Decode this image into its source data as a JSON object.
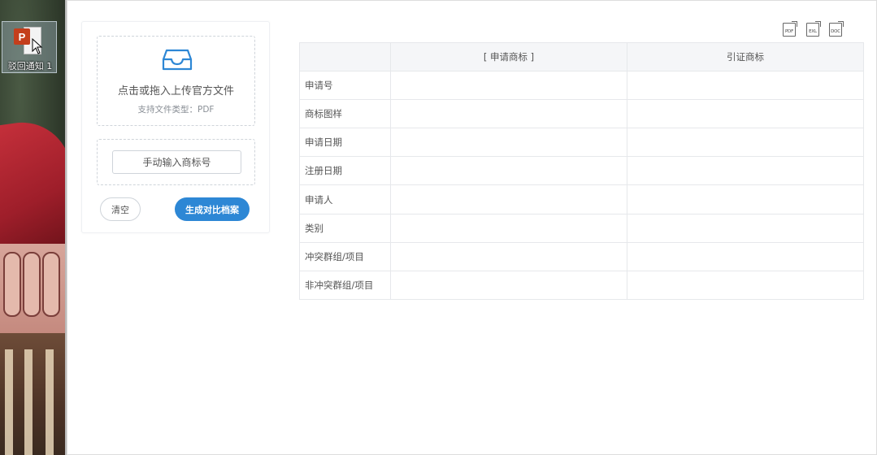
{
  "desktop": {
    "icon_label": "驳回通知 1",
    "icon_badge": "P"
  },
  "upload": {
    "title": "点击或拖入上传官方文件",
    "hint": "支持文件类型：PDF"
  },
  "manual": {
    "button_label": "手动输入商标号"
  },
  "actions": {
    "clear_label": "清空",
    "generate_label": "生成对比档案"
  },
  "export": {
    "pdf_label": "PDF",
    "excel_label": "EXL",
    "doc_label": "DOC"
  },
  "table": {
    "headers": [
      "",
      "[ 申请商标 ]",
      "引证商标"
    ],
    "rows": [
      {
        "label": "申请号",
        "applied": "",
        "cited": ""
      },
      {
        "label": "商标图样",
        "applied": "",
        "cited": ""
      },
      {
        "label": "申请日期",
        "applied": "",
        "cited": ""
      },
      {
        "label": "注册日期",
        "applied": "",
        "cited": ""
      },
      {
        "label": "申请人",
        "applied": "",
        "cited": ""
      },
      {
        "label": "类别",
        "applied": "",
        "cited": ""
      },
      {
        "label": "冲突群组/项目",
        "applied": "",
        "cited": ""
      },
      {
        "label": "非冲突群组/项目",
        "applied": "",
        "cited": ""
      }
    ]
  },
  "colors": {
    "accent": "#2d87d5",
    "border": "#e6e8eb",
    "header_bg": "#f5f6f8"
  }
}
